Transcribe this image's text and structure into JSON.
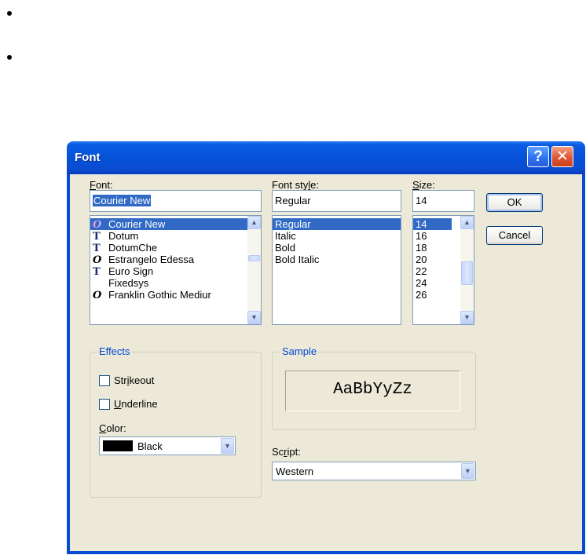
{
  "dialog": {
    "title": "Font",
    "help_glyph": "?",
    "close_glyph": "✕"
  },
  "font": {
    "label": "Font:",
    "value": "Courier New",
    "items": [
      {
        "name": "Courier New",
        "icon": "opentype-icon",
        "selected": true
      },
      {
        "name": "Dotum",
        "icon": "truetype-icon"
      },
      {
        "name": "DotumChe",
        "icon": "truetype-icon"
      },
      {
        "name": "Estrangelo Edessa",
        "icon": "opentype-icon"
      },
      {
        "name": "Euro Sign",
        "icon": "truetype-icon"
      },
      {
        "name": "Fixedsys",
        "icon": "none"
      },
      {
        "name": "Franklin Gothic Mediur",
        "icon": "opentype-icon"
      }
    ]
  },
  "style": {
    "label": "Font style:",
    "value": "Regular",
    "items": [
      "Regular",
      "Italic",
      "Bold",
      "Bold Italic"
    ]
  },
  "size": {
    "label": "Size:",
    "value": "14",
    "items": [
      "14",
      "16",
      "18",
      "20",
      "22",
      "24",
      "26"
    ]
  },
  "buttons": {
    "ok": "OK",
    "cancel": "Cancel"
  },
  "effects": {
    "title": "Effects",
    "strikeout": "Strikeout",
    "underline": "Underline",
    "color_label": "Color:",
    "color_value": "Black",
    "color_swatch": "#000000"
  },
  "sample": {
    "title": "Sample",
    "text": "AaBbYyZz"
  },
  "script": {
    "label": "Script:",
    "value": "Western"
  },
  "colors": {
    "titlebar": "#0552d8",
    "selection": "#316ac5",
    "dialog_bg": "#ece9d8",
    "group_title": "#0046d5"
  }
}
